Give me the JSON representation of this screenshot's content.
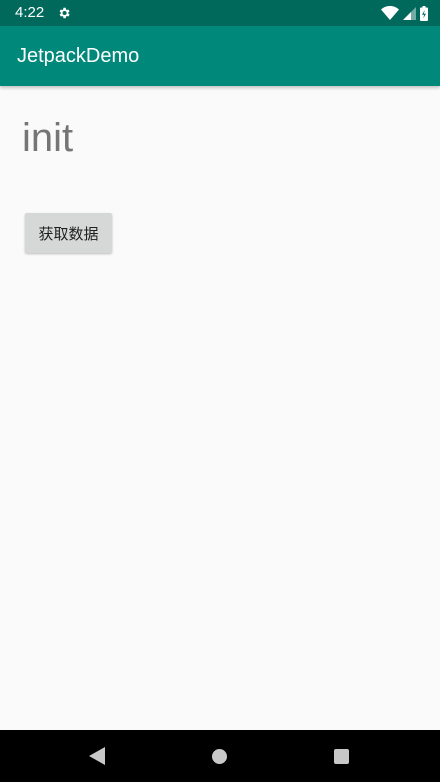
{
  "status_bar": {
    "time": "4:22",
    "icons": [
      "settings-gear-icon",
      "wifi-icon",
      "cell-signal-icon",
      "battery-charging-icon"
    ]
  },
  "app_bar": {
    "title": "JetpackDemo"
  },
  "content": {
    "text": "init",
    "button_label": "获取数据"
  },
  "navigation": {
    "icons": [
      "back-icon",
      "home-icon",
      "recents-icon"
    ]
  },
  "colors": {
    "status_bar": "#00695c",
    "app_bar": "#00897b",
    "background": "#fafafa",
    "button": "#d6d7d7",
    "text_gray": "#757575"
  }
}
